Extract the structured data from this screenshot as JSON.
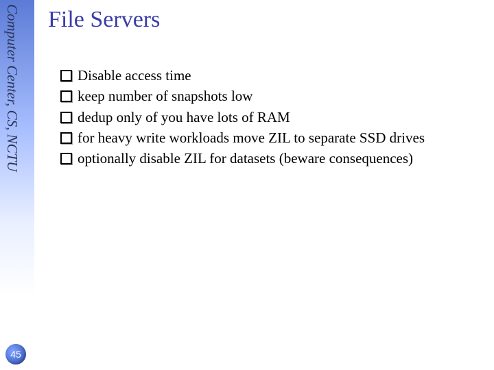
{
  "sidebar": {
    "org_text": "Computer Center, CS, NCTU"
  },
  "page": {
    "number": "45"
  },
  "slide": {
    "title": "File Servers",
    "bullets": [
      "Disable access time",
      "keep number of snapshots low",
      "dedup only of you have lots of RAM",
      "for heavy write workloads move ZIL to separate SSD drives",
      "optionally disable ZIL for datasets (beware consequences)"
    ]
  }
}
